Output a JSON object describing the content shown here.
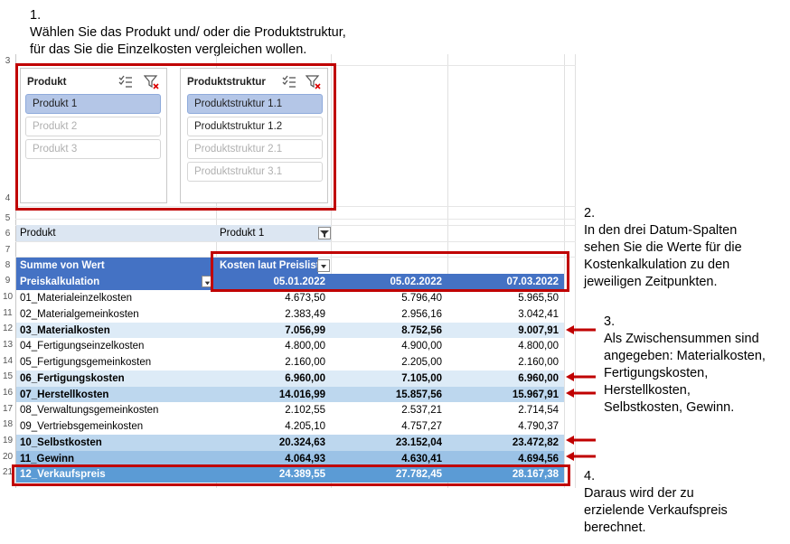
{
  "annotations": {
    "step1": [
      "1.",
      "Wählen Sie das Produkt und/ oder die Produktstruktur,",
      "für das Sie die Einzelkosten vergleichen wollen."
    ],
    "step2": [
      "2.",
      "In den drei Datum-Spalten",
      "sehen Sie die Werte für die",
      "Kostenkalkulation zu den",
      "jeweiligen Zeitpunkten."
    ],
    "step3": [
      "3.",
      "Als Zwischensummen  sind",
      "angegeben: Materialkosten,",
      "Fertigungskosten,",
      "Herstellkosten,",
      "Selbstkosten, Gewinn."
    ],
    "step4": [
      "4.",
      "Daraus wird der zu",
      "erzielende Verkaufspreis",
      "berechnet."
    ]
  },
  "row_numbers": [
    "3",
    "4",
    "5",
    "6",
    "7",
    "8",
    "9",
    "10",
    "11",
    "12",
    "13",
    "14",
    "15",
    "16",
    "17",
    "18",
    "19",
    "20",
    "21"
  ],
  "slicer_product": {
    "title": "Produkt",
    "items": [
      {
        "label": "Produkt 1",
        "state": "selected"
      },
      {
        "label": "Produkt 2",
        "state": "unavailable"
      },
      {
        "label": "Produkt 3",
        "state": "unavailable"
      }
    ]
  },
  "slicer_structure": {
    "title": "Produktstruktur",
    "items": [
      {
        "label": "Produktstruktur 1.1",
        "state": "selected"
      },
      {
        "label": "Produktstruktur 1.2",
        "state": "available"
      },
      {
        "label": "Produktstruktur 2.1",
        "state": "unavailable"
      },
      {
        "label": "Produktstruktur 3.1",
        "state": "unavailable"
      }
    ]
  },
  "filter_row": {
    "label": "Produkt",
    "value": "Produkt 1"
  },
  "pivot": {
    "values_label": "Summe von Wert",
    "column_field": "Kosten laut Preisliste",
    "row_field": "Preiskalkulation",
    "dates": [
      "05.01.2022",
      "05.02.2022",
      "07.03.2022"
    ],
    "rows": [
      {
        "label": "01_Materialeinzelkosten",
        "values": [
          "4.673,50",
          "5.796,40",
          "5.965,50"
        ],
        "style": "normal"
      },
      {
        "label": "02_Materialgemeinkosten",
        "values": [
          "2.383,49",
          "2.956,16",
          "3.042,41"
        ],
        "style": "normal"
      },
      {
        "label": "03_Materialkosten",
        "values": [
          "7.056,99",
          "8.752,56",
          "9.007,91"
        ],
        "style": "sub1"
      },
      {
        "label": "04_Fertigungseinzelkosten",
        "values": [
          "4.800,00",
          "4.900,00",
          "4.800,00"
        ],
        "style": "normal"
      },
      {
        "label": "05_Fertigungsgemeinkosten",
        "values": [
          "2.160,00",
          "2.205,00",
          "2.160,00"
        ],
        "style": "normal"
      },
      {
        "label": "06_Fertigungskosten",
        "values": [
          "6.960,00",
          "7.105,00",
          "6.960,00"
        ],
        "style": "sub1"
      },
      {
        "label": "07_Herstellkosten",
        "values": [
          "14.016,99",
          "15.857,56",
          "15.967,91"
        ],
        "style": "sub2"
      },
      {
        "label": "08_Verwaltungsgemeinkosten",
        "values": [
          "2.102,55",
          "2.537,21",
          "2.714,54"
        ],
        "style": "normal"
      },
      {
        "label": "09_Vertriebsgemeinkosten",
        "values": [
          "4.205,10",
          "4.757,27",
          "4.790,37"
        ],
        "style": "normal"
      },
      {
        "label": "10_Selbstkosten",
        "values": [
          "20.324,63",
          "23.152,04",
          "23.472,82"
        ],
        "style": "sub2"
      },
      {
        "label": "11_Gewinn",
        "values": [
          "4.064,93",
          "4.630,41",
          "4.694,56"
        ],
        "style": "sub3"
      },
      {
        "label": "12_Verkaufspreis",
        "values": [
          "24.389,55",
          "27.782,45",
          "28.167,38"
        ],
        "style": "total"
      }
    ]
  },
  "icons": {
    "multiselect": "multiselect-icon",
    "clear_filter": "clear-filter-icon",
    "dropdown": "dropdown-arrow-icon",
    "funnel": "filter-funnel-icon",
    "annotation_arrow": "red-arrow-icon"
  },
  "colors": {
    "header_blue": "#4472c4",
    "subtotal_light": "#ddebf7",
    "subtotal_mid": "#bdd7ee",
    "subtotal_dark": "#9bc2e6",
    "total_blue": "#5b9bd5",
    "highlight_red": "#c00000",
    "slicer_selected": "#b4c6e7"
  }
}
